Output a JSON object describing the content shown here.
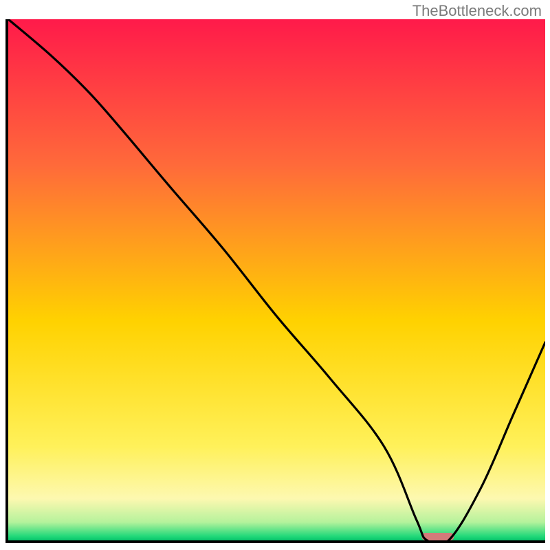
{
  "watermark": "TheBottleneck.com",
  "chart_data": {
    "type": "line",
    "title": "",
    "xlabel": "",
    "ylabel": "",
    "xlim": [
      0,
      100
    ],
    "ylim": [
      0,
      100
    ],
    "grid": false,
    "legend": false,
    "notes": "Vertical gradient background (green bottom → yellow → orange → red top) with a black curve forming an asymmetric V; minimum near x≈78. A small pink/salmon rounded bar marks the minimum on the x-axis.",
    "series": [
      {
        "name": "curve",
        "x": [
          0,
          8,
          15,
          21,
          30,
          40,
          50,
          60,
          70,
          76,
          78,
          82,
          88,
          94,
          100
        ],
        "values": [
          100,
          93,
          86,
          79,
          68,
          56,
          43,
          31,
          18,
          4,
          0,
          0,
          10,
          24,
          38
        ]
      }
    ],
    "marker": {
      "x_center": 80,
      "width_pct": 6
    },
    "gradient_stops": [
      {
        "offset": 0,
        "color": "#ff1a4a"
      },
      {
        "offset": 28,
        "color": "#ff6a3a"
      },
      {
        "offset": 58,
        "color": "#ffd200"
      },
      {
        "offset": 82,
        "color": "#fff15a"
      },
      {
        "offset": 92,
        "color": "#fdf8b0"
      },
      {
        "offset": 96.5,
        "color": "#b5f29c"
      },
      {
        "offset": 99.2,
        "color": "#22d97a"
      },
      {
        "offset": 100,
        "color": "#08c36a"
      }
    ]
  }
}
